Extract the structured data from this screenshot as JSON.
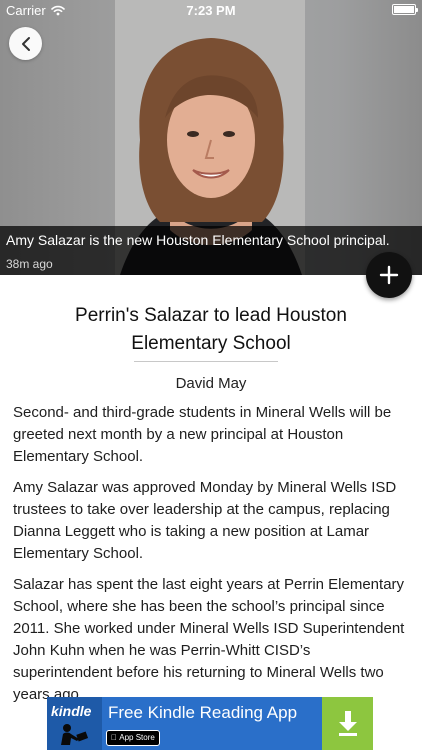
{
  "status_bar": {
    "carrier": "Carrier",
    "time": "7:23 PM",
    "icons": [
      "wifi-icon",
      "battery-icon"
    ],
    "battery_level": 1.0
  },
  "hero": {
    "caption": "Amy Salazar is the new Houston Elementary School principal.",
    "time_ago": "38m ago",
    "back_icon": "chevron-left-icon",
    "fab_icon": "plus-icon"
  },
  "article": {
    "title_line1": "Perrin's Salazar to lead Houston",
    "title_line2": "Elementary School",
    "author": "David May",
    "paragraphs": [
      "Second- and third-grade students in Mineral Wells will be greeted next month by a new principal at Houston Elementary School.",
      "Amy Salazar was approved Monday by Mineral Wells ISD trustees to take over leadership at the campus, replacing Dianna Leggett who is taking a new position at Lamar Elementary School.",
      "Salazar has spent the last eight years at Perrin Elementary School, where she has been the school’s principal since 2011. She worked under Mineral Wells ISD Superintendent John Kuhn when he was Perrin-Whitt CISD’s superintendent before his returning to Mineral Wells two years ago."
    ]
  },
  "ad": {
    "logo_text": "kindle",
    "title": "Free Kindle Reading App",
    "badge": "App Store",
    "icon": "download-arrow-icon",
    "colors": {
      "background": "#2a6fc9",
      "download": "#8dc63f"
    }
  }
}
